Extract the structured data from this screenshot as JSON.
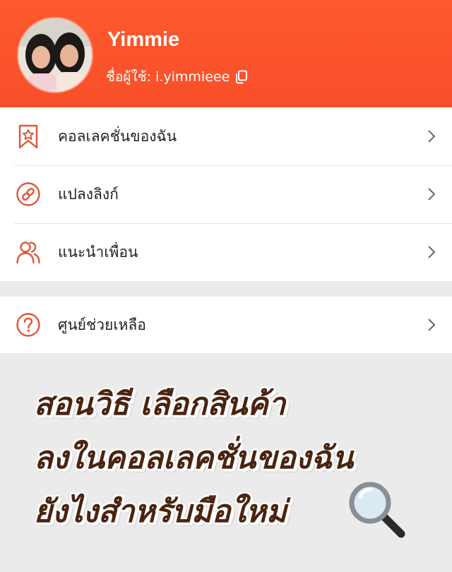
{
  "profile": {
    "name": "Yimmie",
    "handle": "ชื่อผู้ใช้: i.yimmieee"
  },
  "menu": [
    {
      "label": "คอลเลคชั่นของฉัน",
      "icon": "bookmark-star-icon"
    },
    {
      "label": "แปลงลิงก์",
      "icon": "link-icon"
    },
    {
      "label": "แนะนำเพื่อน",
      "icon": "friends-icon"
    }
  ],
  "help": {
    "label": "ศูนย์ช่วยเหลือ",
    "icon": "help-circle-icon"
  },
  "caption": {
    "line1": "สอนวิธี เลือกสินค้า",
    "line2": "ลงในคอลเลคชั่นของฉัน",
    "line3": "ยังไงสำหรับมือใหม่"
  },
  "colors": {
    "header": "#ff5a2e",
    "accent_icon": "#e0553a",
    "caption_text": "#4a2410",
    "background": "#ebebeb"
  }
}
